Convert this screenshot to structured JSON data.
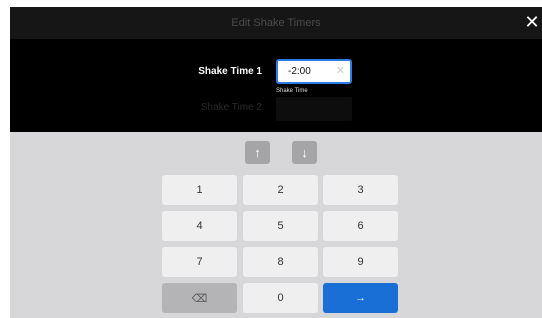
{
  "dialog": {
    "title": "Edit Shake Timers",
    "close_glyph": "✕"
  },
  "fields": {
    "shake_time_1": {
      "label": "Shake Time 1",
      "value": "-2:00",
      "clear_glyph": "✕",
      "caption": "Shake Time"
    },
    "shake_time_2": {
      "label": "Shake Time 2"
    }
  },
  "keypad": {
    "up_glyph": "↑",
    "down_glyph": "↓",
    "keys": [
      "1",
      "2",
      "3",
      "4",
      "5",
      "6",
      "7",
      "8",
      "9"
    ],
    "zero": "0",
    "backspace_glyph": "⌫",
    "enter_glyph": "→"
  },
  "colors": {
    "accent": "#1a6fd6",
    "focus_border": "#2e7ce6",
    "keyboard_bg": "#d7d7d9"
  }
}
